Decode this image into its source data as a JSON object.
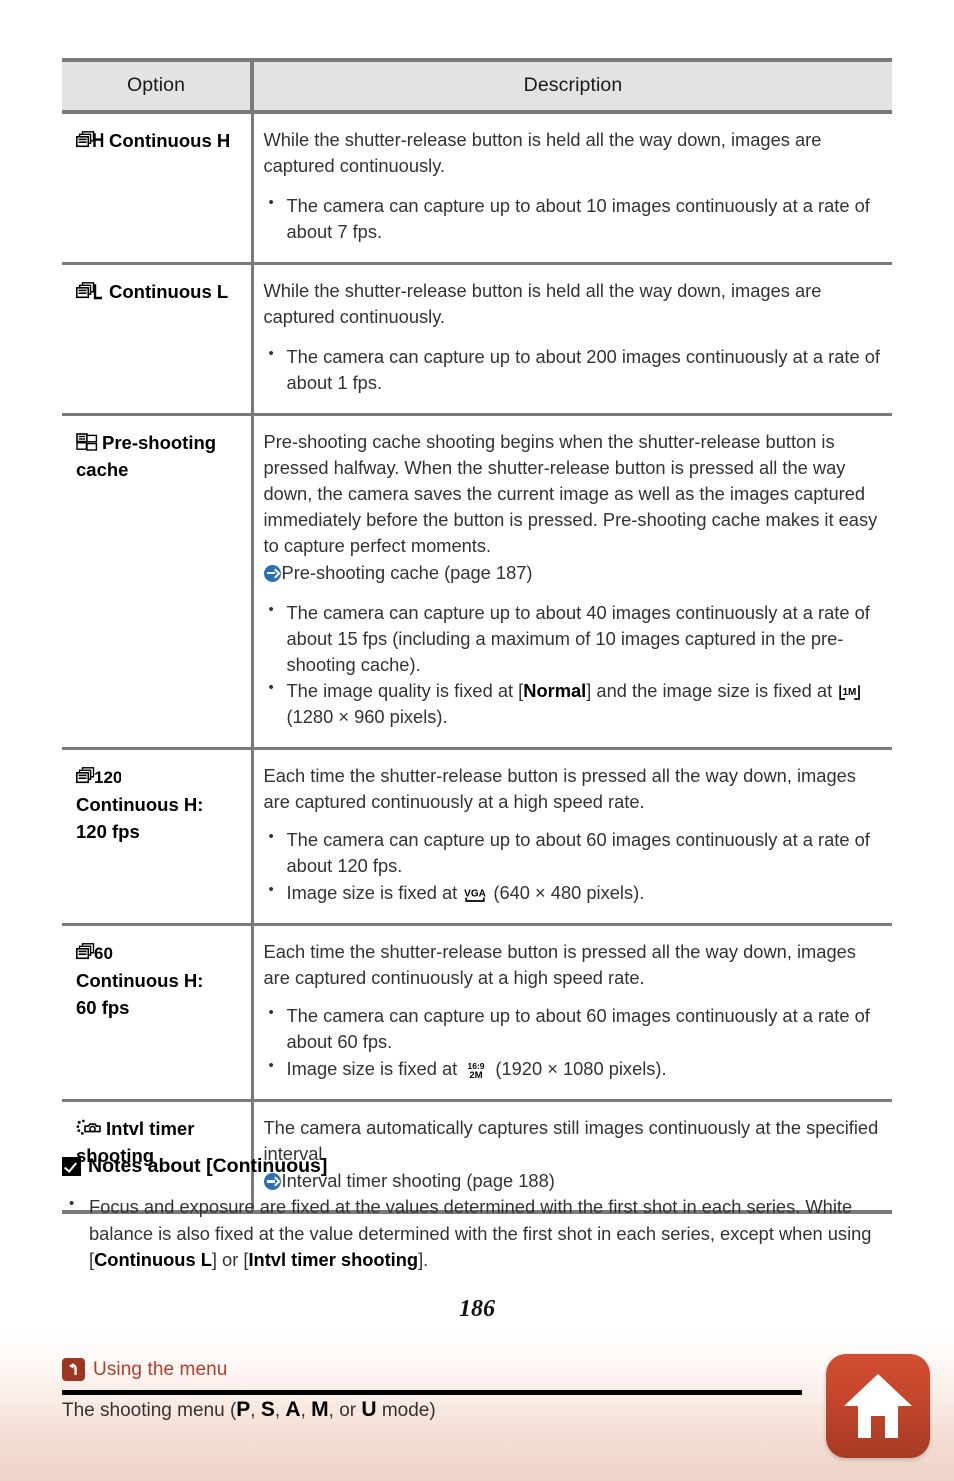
{
  "table": {
    "headers": {
      "option": "Option",
      "description": "Description"
    },
    "rows": [
      {
        "icon": "burst-frames-h-icon",
        "option_label": "Continuous H",
        "paragraphs": [
          "While the shutter-release button is held all the way down, images are captured continuously."
        ],
        "bullets": [
          "The camera can capture up to about 10 images continuously at a rate of about 7 fps."
        ]
      },
      {
        "icon": "burst-frames-l-icon",
        "option_label": "Continuous L",
        "paragraphs": [
          "While the shutter-release button is held all the way down, images are captured continuously."
        ],
        "bullets": [
          "The camera can capture up to about 200 images continuously at a rate of about 1 fps."
        ]
      },
      {
        "icon": "pre-shooting-cache-icon",
        "option_label": "Pre-shooting cache",
        "paragraphs": [
          "Pre-shooting cache shooting begins when the shutter-release button is pressed halfway. When the shutter-release button is pressed all the way down, the camera saves the current image as well as the images captured immediately before the button is pressed. Pre-shooting cache makes it easy to capture perfect moments."
        ],
        "xref": "Pre-shooting cache (page 187)",
        "bullets": [
          "The camera can capture up to about 40 images continuously at a rate of about 15 fps (including a maximum of 10 images captured in the pre-shooting cache).",
          "The image quality is fixed at [Normal] and the image size is fixed at (1280 × 960 pixels)."
        ],
        "bullet2_prefix": "The image quality is fixed at [",
        "bullet2_bold": "Normal",
        "bullet2_mid": "] and the image size is fixed at ",
        "bullet2_suffix": " (1280 × 960 pixels).",
        "size_icon": "image-size-1m-icon"
      },
      {
        "icon": "burst-120-icon",
        "option_label_line1": "Continuous H:",
        "option_label_line2": "120 fps",
        "paragraphs": [
          "Each time the shutter-release button is pressed all the way down, images are captured continuously at a high speed rate."
        ],
        "bullets": [
          "The camera can capture up to about 60 images continuously at a rate of about 120 fps."
        ],
        "size_bullet_prefix": "Image size is fixed at ",
        "size_bullet_suffix": " (640 × 480 pixels).",
        "size_icon": "image-size-vga-icon"
      },
      {
        "icon": "burst-60-icon",
        "option_label_line1": "Continuous H:",
        "option_label_line2": "60 fps",
        "paragraphs": [
          "Each time the shutter-release button is pressed all the way down, images are captured continuously at a high speed rate."
        ],
        "bullets": [
          "The camera can capture up to about 60 images continuously at a rate of about 60 fps."
        ],
        "size_bullet_prefix": "Image size is fixed at ",
        "size_bullet_suffix": " (1920 × 1080 pixels).",
        "size_icon": "image-size-16-9-2m-icon"
      },
      {
        "icon": "interval-timer-icon",
        "option_label": "Intvl timer shooting",
        "paragraphs": [
          "The camera automatically captures still images continuously at the specified interval."
        ],
        "xref": "Interval timer shooting (page 188)"
      }
    ]
  },
  "notes": {
    "heading": "Notes about [Continuous]",
    "item_part1": "Focus and exposure are fixed at the values determined with the first shot in each series. White balance is also fixed at the value determined with the first shot in each series, except when using [",
    "item_bold1": "Continuous L",
    "item_mid": "] or [",
    "item_bold2": "Intvl timer shooting",
    "item_end": "]."
  },
  "page_number": "186",
  "footer": {
    "breadcrumb": "Using the menu",
    "subtitle_prefix": "The shooting menu (",
    "modes": [
      "P",
      "S",
      "A",
      "M"
    ],
    "subtitle_or": " or ",
    "mode_last": "U",
    "subtitle_suffix": " mode)",
    "home_icon": "home-icon",
    "back_icon": "back-arrow-icon",
    "accent_color": "#b23d28",
    "home_color": "#c2452c"
  }
}
